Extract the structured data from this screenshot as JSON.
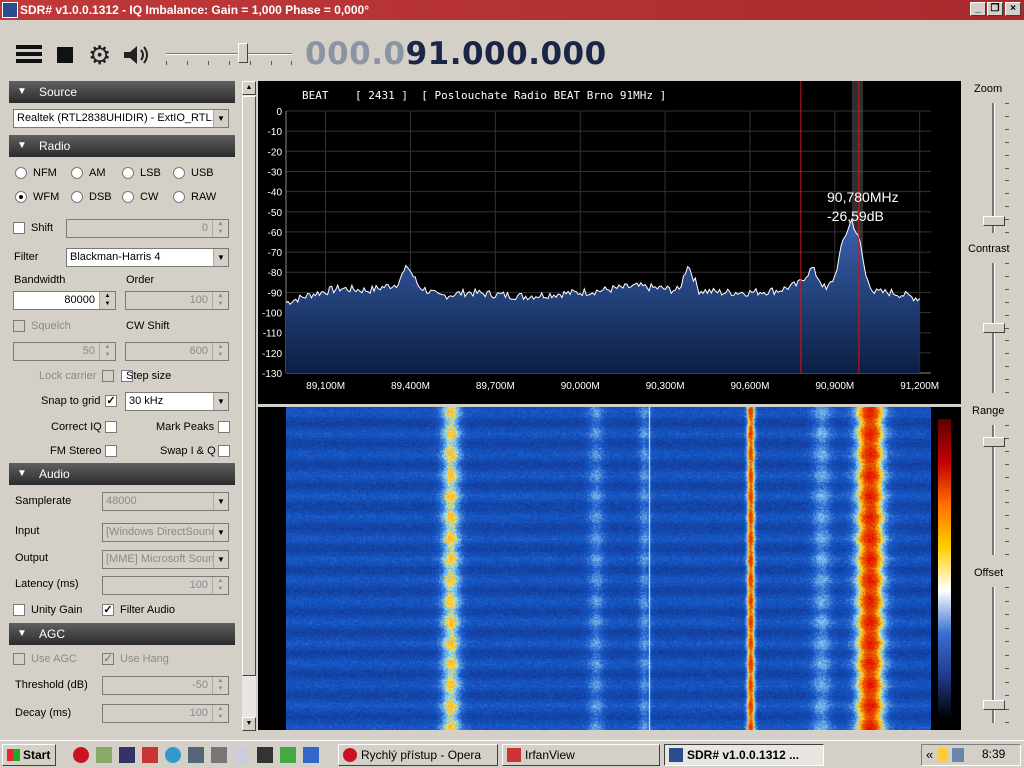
{
  "window": {
    "title": "SDR# v1.0.0.1312 - IQ Imbalance: Gain = 1,000 Phase = 0,000°",
    "minimize": "_",
    "restore": "❐",
    "close": "×"
  },
  "toolbar": {
    "frequency_dim": "000.0",
    "frequency_bright": "91.000.000",
    "volume_level": 0.62
  },
  "source": {
    "header": "Source",
    "device": "Realtek (RTL2838UHIDIR) - ExtIO_RTL.dll"
  },
  "radio": {
    "header": "Radio",
    "modes": [
      "NFM",
      "AM",
      "LSB",
      "USB",
      "WFM",
      "DSB",
      "CW",
      "RAW"
    ],
    "selected_mode": "WFM",
    "shift_label": "Shift",
    "shift_value": "0",
    "filter_label": "Filter",
    "filter_value": "Blackman-Harris 4",
    "bandwidth_label": "Bandwidth",
    "bandwidth_value": "80000",
    "order_label": "Order",
    "order_value": "100",
    "squelch_label": "Squelch",
    "squelch_value": "50",
    "cwshift_label": "CW Shift",
    "cwshift_value": "600",
    "lock_carrier_label": "Lock carrier",
    "step_size_label": "Step size",
    "snap_label": "Snap to grid",
    "snap_value": "30 kHz",
    "correct_iq_label": "Correct IQ",
    "mark_peaks_label": "Mark Peaks",
    "fm_stereo_label": "FM Stereo",
    "swap_iq_label": "Swap I & Q",
    "checks": {
      "shift": false,
      "squelch": false,
      "snap": true,
      "correct_iq": false,
      "mark_peaks": false,
      "fm_stereo": false,
      "swap_iq": false
    }
  },
  "audio": {
    "header": "Audio",
    "samplerate_label": "Samplerate",
    "samplerate_value": "48000",
    "input_label": "Input",
    "input_value": "[Windows DirectSound] ...",
    "output_label": "Output",
    "output_value": "[MME] Microsoft Sound ...",
    "latency_label": "Latency (ms)",
    "latency_value": "100",
    "unity_gain_label": "Unity Gain",
    "filter_audio_label": "Filter Audio",
    "checks": {
      "unity_gain": false,
      "filter_audio": true
    }
  },
  "agc": {
    "header": "AGC",
    "use_agc_label": "Use AGC",
    "use_hang_label": "Use Hang",
    "threshold_label": "Threshold (dB)",
    "threshold_value": "-50",
    "decay_label": "Decay (ms)",
    "decay_value": "100",
    "checks": {
      "use_agc": false,
      "use_hang": true
    }
  },
  "spectrum": {
    "station_text": "BEAT    [ 2431 ]  [ Poslouchate Radio BEAT Brno 91MHz ]",
    "cursor_freq": "90,780MHz",
    "cursor_level": "-26,59dB",
    "colors": {
      "fill": "#2a4d8f",
      "trace": "#ffffff",
      "marker": "#d01818",
      "grid": "#333333"
    }
  },
  "chart_data": {
    "type": "area",
    "title": "",
    "xlabel": "",
    "ylabel": "",
    "xlim": [
      88.96,
      91.24
    ],
    "ylim": [
      -130,
      0
    ],
    "grid": true,
    "yticks": [
      "0",
      "-10",
      "-20",
      "-30",
      "-40",
      "-50",
      "-60",
      "-70",
      "-80",
      "-90",
      "-100",
      "-110",
      "-120",
      "-130"
    ],
    "xticks": [
      "89,100M",
      "89,400M",
      "89,700M",
      "90,000M",
      "90,300M",
      "90,600M",
      "90,900M",
      "91,200M"
    ],
    "xtick_values": [
      89.1,
      89.4,
      89.7,
      90.0,
      90.3,
      90.6,
      90.9,
      91.2
    ],
    "x": [
      88.96,
      89.05,
      89.15,
      89.25,
      89.35,
      89.39,
      89.43,
      89.5,
      89.6,
      89.7,
      89.8,
      89.9,
      90.0,
      90.08,
      90.13,
      90.2,
      90.28,
      90.35,
      90.38,
      90.42,
      90.5,
      90.6,
      90.7,
      90.77,
      90.82,
      90.87,
      90.9,
      90.93,
      90.96,
      90.99,
      91.01,
      91.04,
      91.1,
      91.2
    ],
    "values": [
      -95,
      -91,
      -88,
      -89,
      -86,
      -77,
      -87,
      -92,
      -90,
      -91,
      -92,
      -91,
      -90,
      -89,
      -88,
      -87,
      -88,
      -89,
      -76,
      -89,
      -90,
      -90,
      -89,
      -86,
      -78,
      -89,
      -82,
      -64,
      -54,
      -66,
      -82,
      -90,
      -90,
      -93
    ],
    "markers": {
      "red_line": 90.78,
      "red_line_2": 90.985,
      "band": [
        90.96,
        91.0
      ]
    }
  },
  "waterfall": {
    "colorbar": [
      "#000000",
      "#203a8a",
      "#3a6fd0",
      "#ffffff",
      "#ffd000",
      "#ff7000",
      "#c00000",
      "#600000"
    ]
  },
  "right": {
    "zoom_label": "Zoom",
    "contrast_label": "Contrast",
    "range_label": "Range",
    "offset_label": "Offset",
    "zoom_level": 0.94,
    "contrast_level": 0.5,
    "range_level": 0.1,
    "offset_level": 0.9
  },
  "taskbar": {
    "start": "Start",
    "tasks": [
      "Rychlý přístup - Opera",
      "IrfanView",
      "SDR# v1.0.0.1312 ..."
    ],
    "tray_lang": "«",
    "clock": "8:39"
  }
}
